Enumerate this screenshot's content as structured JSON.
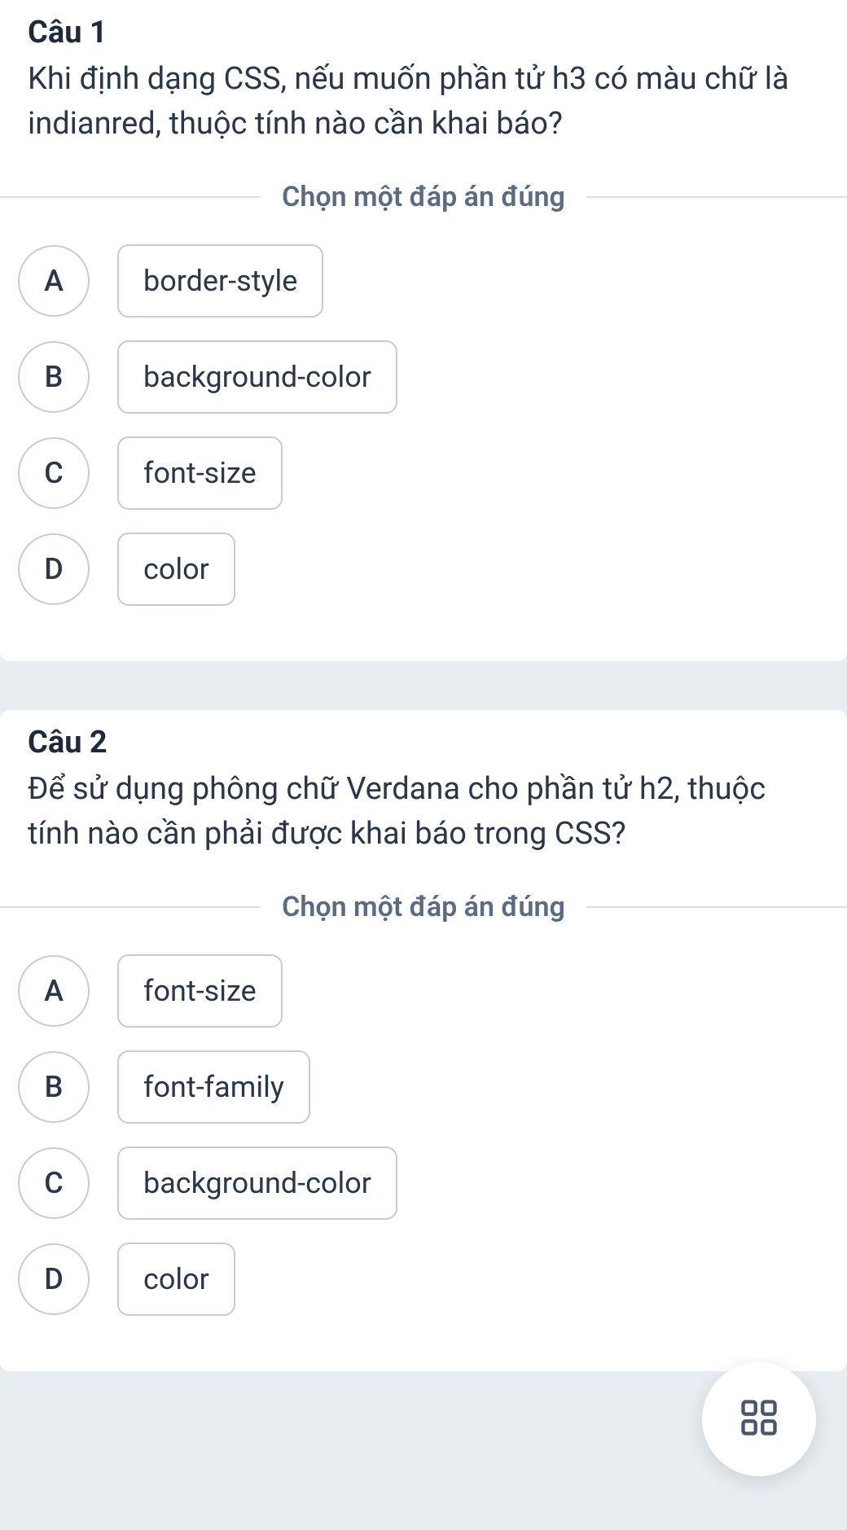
{
  "instruction_label": "Chọn một đáp án đúng",
  "questions": [
    {
      "title": "Câu 1",
      "text": "Khi định dạng CSS, nếu muốn phần tử h3 có màu chữ là indianred, thuộc tính nào cần khai báo?",
      "options": [
        {
          "letter": "A",
          "label": "border-style"
        },
        {
          "letter": "B",
          "label": "background-color"
        },
        {
          "letter": "C",
          "label": "font-size"
        },
        {
          "letter": "D",
          "label": "color"
        }
      ]
    },
    {
      "title": "Câu 2",
      "text": "Để sử dụng phông chữ Verdana cho phần tử h2, thuộc tính nào cần phải được khai báo trong CSS?",
      "options": [
        {
          "letter": "A",
          "label": "font-size"
        },
        {
          "letter": "B",
          "label": "font-family"
        },
        {
          "letter": "C",
          "label": "background-color"
        },
        {
          "letter": "D",
          "label": "color"
        }
      ]
    }
  ],
  "fab": {
    "icon": "grid-icon"
  }
}
